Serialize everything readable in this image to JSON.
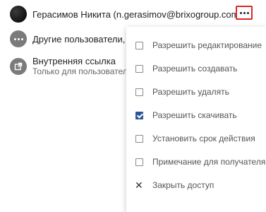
{
  "users": [
    {
      "name": "Герасимов Никита (n.gerasimov@brixogroup.com)"
    },
    {
      "name": "Другие пользователи, име"
    }
  ],
  "internal_link": {
    "title": "Внутренняя ссылка",
    "subtitle": "Только для пользователей"
  },
  "menu": {
    "items": [
      {
        "label": "Разрешить редактирование",
        "checked": false
      },
      {
        "label": "Разрешить создавать",
        "checked": false
      },
      {
        "label": "Разрешить удалять",
        "checked": false
      },
      {
        "label": "Разрешить скачивать",
        "checked": true
      },
      {
        "label": "Установить срок действия",
        "checked": false
      },
      {
        "label": "Примечание для получателя",
        "checked": false
      }
    ],
    "close_label": "Закрыть доступ"
  },
  "colors": {
    "accent": "#2b5797",
    "highlight_border": "#e02424"
  },
  "icons": [
    "avatar",
    "more-horizontal-icon",
    "external-link-icon",
    "close-icon"
  ]
}
